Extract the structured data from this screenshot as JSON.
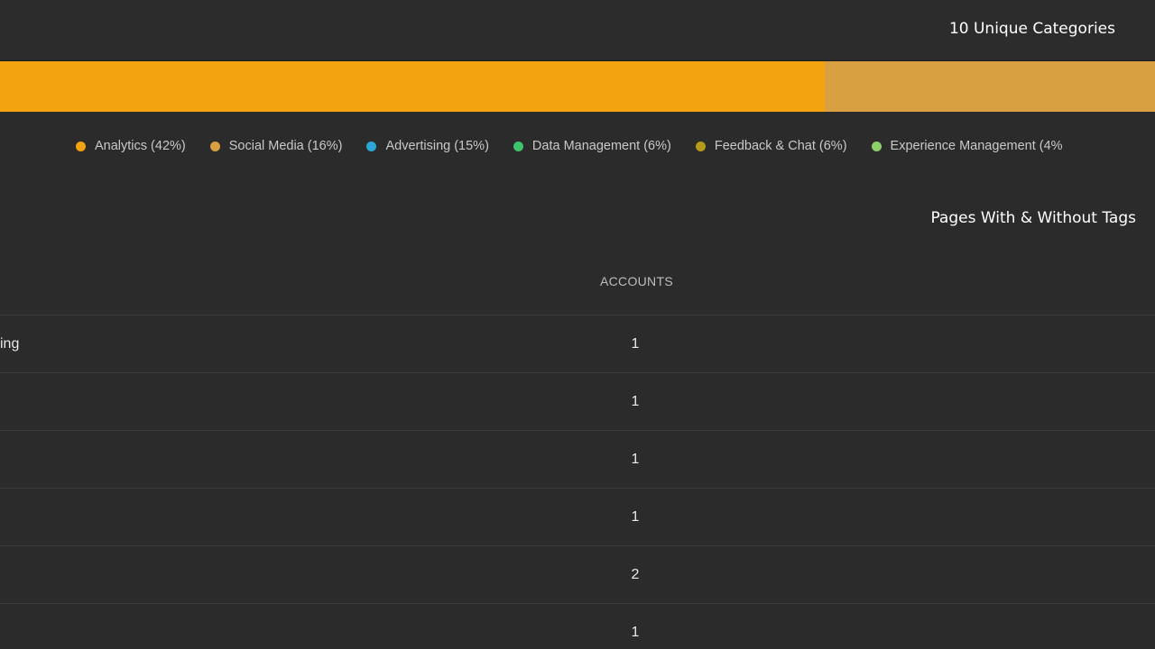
{
  "header": {
    "categories_title": "10 Unique Categories"
  },
  "category_bar": {
    "segments": [
      {
        "name": "Analytics",
        "fraction": 0.714,
        "color": "#f2a30f"
      },
      {
        "name": "Social Media",
        "fraction": 0.286,
        "color": "#d8a040"
      }
    ]
  },
  "legend": {
    "items": [
      {
        "label": "Analytics (42%)",
        "color": "#f2a30f"
      },
      {
        "label": "Social Media (16%)",
        "color": "#d8a040"
      },
      {
        "label": "Advertising (15%)",
        "color": "#2ba9d6"
      },
      {
        "label": "Data Management (6%)",
        "color": "#3ec46d"
      },
      {
        "label": "Feedback & Chat (6%)",
        "color": "#b59a1c"
      },
      {
        "label": "Experience Management (4%",
        "color": "#8fcf6a"
      }
    ]
  },
  "pages_section": {
    "title": "Pages With & Without Tags"
  },
  "table": {
    "columns": {
      "accounts": "ACCOUNTS"
    },
    "rows": [
      {
        "name": "king",
        "accounts": "1"
      },
      {
        "name": "",
        "accounts": "1"
      },
      {
        "name": "",
        "accounts": "1"
      },
      {
        "name": "",
        "accounts": "1"
      },
      {
        "name": "",
        "accounts": "2"
      },
      {
        "name": "",
        "accounts": "1"
      }
    ]
  }
}
